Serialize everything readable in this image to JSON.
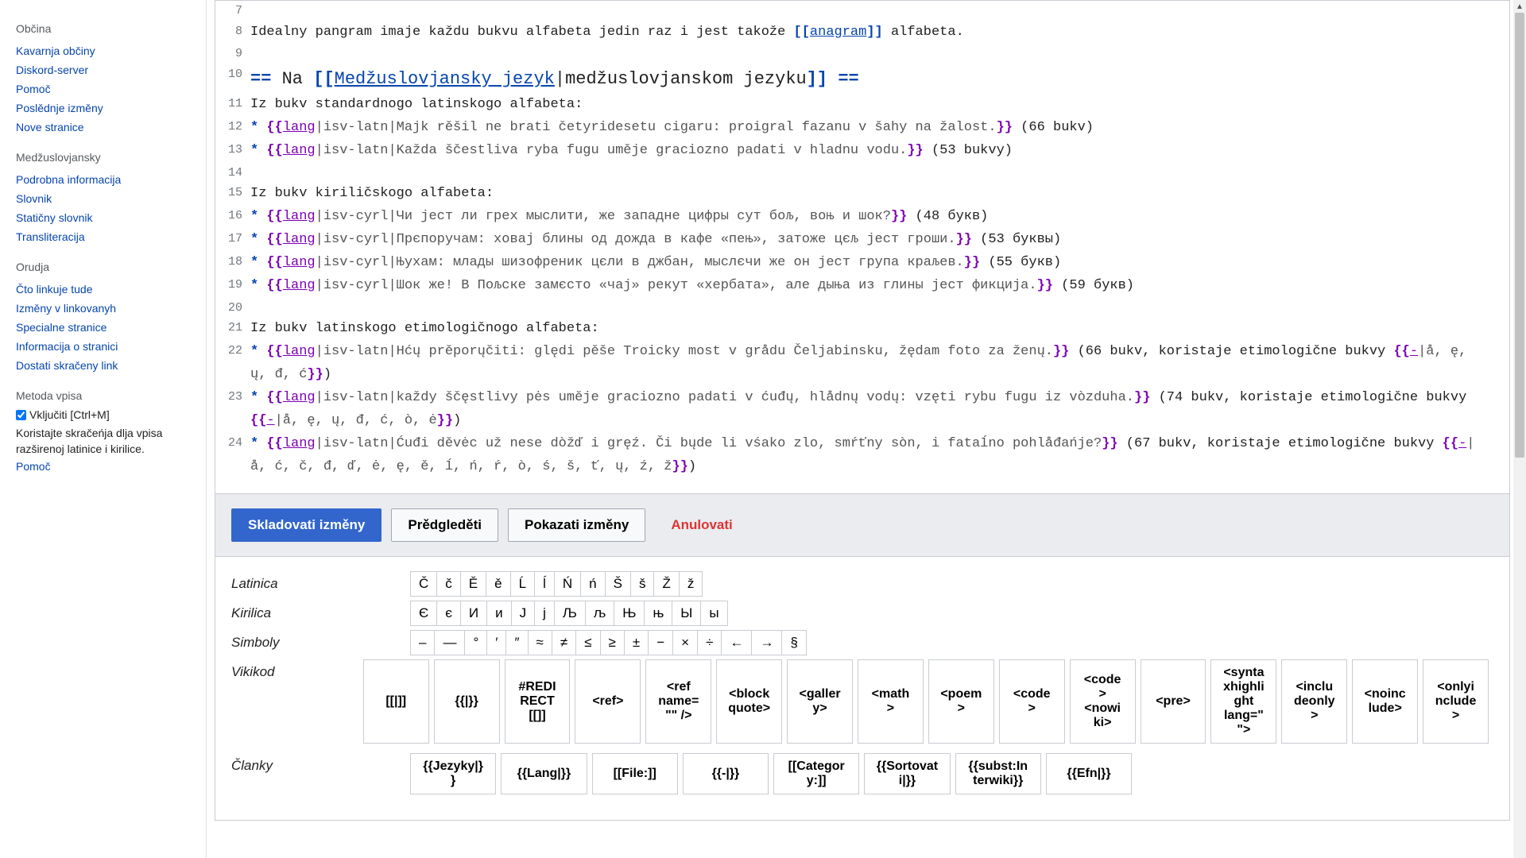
{
  "sidebar": {
    "groups": [
      {
        "title": "Občina",
        "items": [
          "Kavarnja občiny",
          "Diskord-server",
          "Pomoč",
          "Poslědnje izměny",
          "Nove stranice"
        ]
      },
      {
        "title": "Medžuslovjansky",
        "items": [
          "Podrobna informacija",
          "Slovnik",
          "Statičny slovnik",
          "Transliteracija"
        ]
      },
      {
        "title": "Orudja",
        "items": [
          "Čto linkuje tude",
          "Izměny v linkovanyh",
          "Specialne stranice",
          "Informacija o stranici",
          "Dostati skračeny link"
        ]
      }
    ],
    "input_method": {
      "title": "Metoda vpisa",
      "enable_label": "Vključiti [Ctrl+M]",
      "note": "Koristajte skračeńja dlja vpisa razširenoj latinice i kirilice.",
      "help": "Pomoč"
    }
  },
  "editor": {
    "lines": [
      {
        "n": 7,
        "segments": []
      },
      {
        "n": 8,
        "segments": [
          {
            "t": "Idealny pangram imaje každu bukvu alfabeta jedin raz i jest takože "
          },
          {
            "t": "[[",
            "c": "delim"
          },
          {
            "t": "anagram",
            "c": "link"
          },
          {
            "t": "]]",
            "c": "delim"
          },
          {
            "t": " alfabeta."
          }
        ]
      },
      {
        "n": 9,
        "segments": []
      },
      {
        "n": 10,
        "heading": true,
        "segments": [
          {
            "t": "== ",
            "c": "delim"
          },
          {
            "t": "Na "
          },
          {
            "t": "[[",
            "c": "delim"
          },
          {
            "t": "Medžuslovjansky jezyk",
            "c": "link"
          },
          {
            "t": "|medžuslovjanskom jezyku"
          },
          {
            "t": "]]",
            "c": "delim"
          },
          {
            "t": " ==",
            "c": "delim"
          }
        ]
      },
      {
        "n": 11,
        "segments": [
          {
            "t": "Iz bukv standardnogo latinskogo alfabeta:"
          }
        ]
      },
      {
        "n": 12,
        "segments": [
          {
            "t": "* ",
            "c": "delim"
          },
          {
            "t": "{{",
            "c": "tmpl-open"
          },
          {
            "t": "lang",
            "c": "tmpl-name"
          },
          {
            "t": "|isv-latn|Majk rěšil ne brati četyridesetu cigaru: proigral fazanu v šahy na žalost.",
            "c": "tmpl-args"
          },
          {
            "t": "}}",
            "c": "tmpl-close"
          },
          {
            "t": " (66 bukv)"
          }
        ]
      },
      {
        "n": 13,
        "segments": [
          {
            "t": "* ",
            "c": "delim"
          },
          {
            "t": "{{",
            "c": "tmpl-open"
          },
          {
            "t": "lang",
            "c": "tmpl-name"
          },
          {
            "t": "|isv-latn|Každa ščestliva ryba fugu uměje graciozno padati v hladnu vodu.",
            "c": "tmpl-args"
          },
          {
            "t": "}}",
            "c": "tmpl-close"
          },
          {
            "t": " (53 bukvy)"
          }
        ]
      },
      {
        "n": 14,
        "segments": []
      },
      {
        "n": 15,
        "segments": [
          {
            "t": "Iz bukv kiriličskogo alfabeta:"
          }
        ]
      },
      {
        "n": 16,
        "segments": [
          {
            "t": "* ",
            "c": "delim"
          },
          {
            "t": "{{",
            "c": "tmpl-open"
          },
          {
            "t": "lang",
            "c": "tmpl-name"
          },
          {
            "t": "|isv-cyrl|Чи јест ли грех мыслити, же западне цифры сут бољ, воњ и шок?",
            "c": "tmpl-args"
          },
          {
            "t": "}}",
            "c": "tmpl-close"
          },
          {
            "t": " (48 букв)"
          }
        ]
      },
      {
        "n": 17,
        "segments": [
          {
            "t": "* ",
            "c": "delim"
          },
          {
            "t": "{{",
            "c": "tmpl-open"
          },
          {
            "t": "lang",
            "c": "tmpl-name"
          },
          {
            "t": "|isv-cyrl|Прєпоручам: ховај блины од дожда в кафе «пењ», затоже цєљ јест гроши.",
            "c": "tmpl-args"
          },
          {
            "t": "}}",
            "c": "tmpl-close"
          },
          {
            "t": " (53 буквы)"
          }
        ]
      },
      {
        "n": 18,
        "segments": [
          {
            "t": "* ",
            "c": "delim"
          },
          {
            "t": "{{",
            "c": "tmpl-open"
          },
          {
            "t": "lang",
            "c": "tmpl-name"
          },
          {
            "t": "|isv-cyrl|Њухам: млады шизофреник цєли в джбан, мыслєчи же он јест група краљев.",
            "c": "tmpl-args"
          },
          {
            "t": "}}",
            "c": "tmpl-close"
          },
          {
            "t": " (55 букв)"
          }
        ]
      },
      {
        "n": 19,
        "segments": [
          {
            "t": "* ",
            "c": "delim"
          },
          {
            "t": "{{",
            "c": "tmpl-open"
          },
          {
            "t": "lang",
            "c": "tmpl-name"
          },
          {
            "t": "|isv-cyrl|Шок же! В Пољске замєсто «чај» рекут «хербата», але дыња из глины јест фикција.",
            "c": "tmpl-args"
          },
          {
            "t": "}}",
            "c": "tmpl-close"
          },
          {
            "t": " (59 букв)"
          }
        ]
      },
      {
        "n": 20,
        "segments": []
      },
      {
        "n": 21,
        "segments": [
          {
            "t": "Iz bukv latinskogo etimologičnogo alfabeta:"
          }
        ]
      },
      {
        "n": 22,
        "segments": [
          {
            "t": "* ",
            "c": "delim"
          },
          {
            "t": "{{",
            "c": "tmpl-open"
          },
          {
            "t": "lang",
            "c": "tmpl-name"
          },
          {
            "t": "|isv-latn|Hćų prěporųčiti: ględi pěše Troicky most v grådu Čeljabinsku, žędam foto za ženų.",
            "c": "tmpl-args"
          },
          {
            "t": "}}",
            "c": "tmpl-close"
          },
          {
            "t": " (66 bukv, koristaje etimologične bukvy "
          },
          {
            "t": "{{",
            "c": "tmpl-open"
          },
          {
            "t": "-",
            "c": "tmpl-name"
          },
          {
            "t": "|å, ę, ų, đ, ć",
            "c": "tmpl-args"
          },
          {
            "t": "}}",
            "c": "tmpl-close"
          },
          {
            "t": ")"
          }
        ]
      },
      {
        "n": 23,
        "segments": [
          {
            "t": "* ",
            "c": "delim"
          },
          {
            "t": "{{",
            "c": "tmpl-open"
          },
          {
            "t": "lang",
            "c": "tmpl-name"
          },
          {
            "t": "|isv-latn|každy ščęstlivy pės umĕje graciozno padati v ćuđų, hlådnų vodų: vzęti rybu fugu iz vòzduha.",
            "c": "tmpl-args"
          },
          {
            "t": "}}",
            "c": "tmpl-close"
          },
          {
            "t": " (74 bukv, koristaje etimologične bukvy "
          },
          {
            "t": "{{",
            "c": "tmpl-open"
          },
          {
            "t": "-",
            "c": "tmpl-name"
          },
          {
            "t": "|å, ę, ų, đ, ć, ò, ė",
            "c": "tmpl-args"
          },
          {
            "t": "}}",
            "c": "tmpl-close"
          },
          {
            "t": ")"
          }
        ]
      },
      {
        "n": 24,
        "segments": [
          {
            "t": "* ",
            "c": "delim"
          },
          {
            "t": "{{",
            "c": "tmpl-open"
          },
          {
            "t": "lang",
            "c": "tmpl-name"
          },
          {
            "t": "|isv-latn|Ćuđi děvėc už nese dòžď i gręź. Či bųde li vśako zlo, smŕťny sòn, i fataĺno pohlåđańje?",
            "c": "tmpl-args"
          },
          {
            "t": "}}",
            "c": "tmpl-close"
          },
          {
            "t": " (67 bukv, koristaje etimologične bukvy "
          },
          {
            "t": "{{",
            "c": "tmpl-open"
          },
          {
            "t": "-",
            "c": "tmpl-name"
          },
          {
            "t": "|å, ć, č, đ, ď, ė, ę, ě, ĺ, ń, ŕ, ò, ś, š, ť, ų, ź, ž",
            "c": "tmpl-args"
          },
          {
            "t": "}}",
            "c": "tmpl-close"
          },
          {
            "t": ")"
          }
        ]
      }
    ]
  },
  "buttons": {
    "save": "Skladovati izměny",
    "preview": "Prědgleděti",
    "diff": "Pokazati izměny",
    "cancel": "Anulovati"
  },
  "chartool": {
    "rows": [
      {
        "label": "Latinica",
        "items": [
          "Č",
          "č",
          "Ě",
          "ě",
          "Ĺ",
          "ĺ",
          "Ń",
          "ń",
          "Š",
          "š",
          "Ž",
          "ž"
        ]
      },
      {
        "label": "Kirilica",
        "items": [
          "Є",
          "є",
          "И",
          "и",
          "Ј",
          "ј",
          "Љ",
          "љ",
          "Њ",
          "њ",
          "Ы",
          "ы"
        ]
      },
      {
        "label": "Simboly",
        "items": [
          "–",
          "—",
          "°",
          "′",
          "″",
          "≈",
          "≠",
          "≤",
          "≥",
          "±",
          "−",
          "×",
          "÷",
          "←",
          "→",
          "§"
        ]
      },
      {
        "label": "Vikikod",
        "code": true,
        "items": [
          "[[|]]",
          "{{|}}",
          "#REDIRECT [[]]",
          "<ref>",
          "<ref name=\"\" />",
          "<blockquote>",
          "<gallery>",
          "<math>",
          "<poem>",
          "<code>",
          "<code><nowiki>",
          "<pre>",
          "<syntaxhighlight lang=\"\">",
          "<includeonly>",
          "<noinclude>",
          "<onlyinclude>"
        ]
      },
      {
        "label": "Članky",
        "code": true,
        "items": [
          "{{Jezyky|}}",
          "{{Lang|}}",
          "[[File:]]",
          "{{-|}}",
          "[[Category:]]",
          "{{Sortovati|}}",
          "{{subst:Interwiki}}",
          "{{Efn|}}"
        ]
      }
    ]
  }
}
